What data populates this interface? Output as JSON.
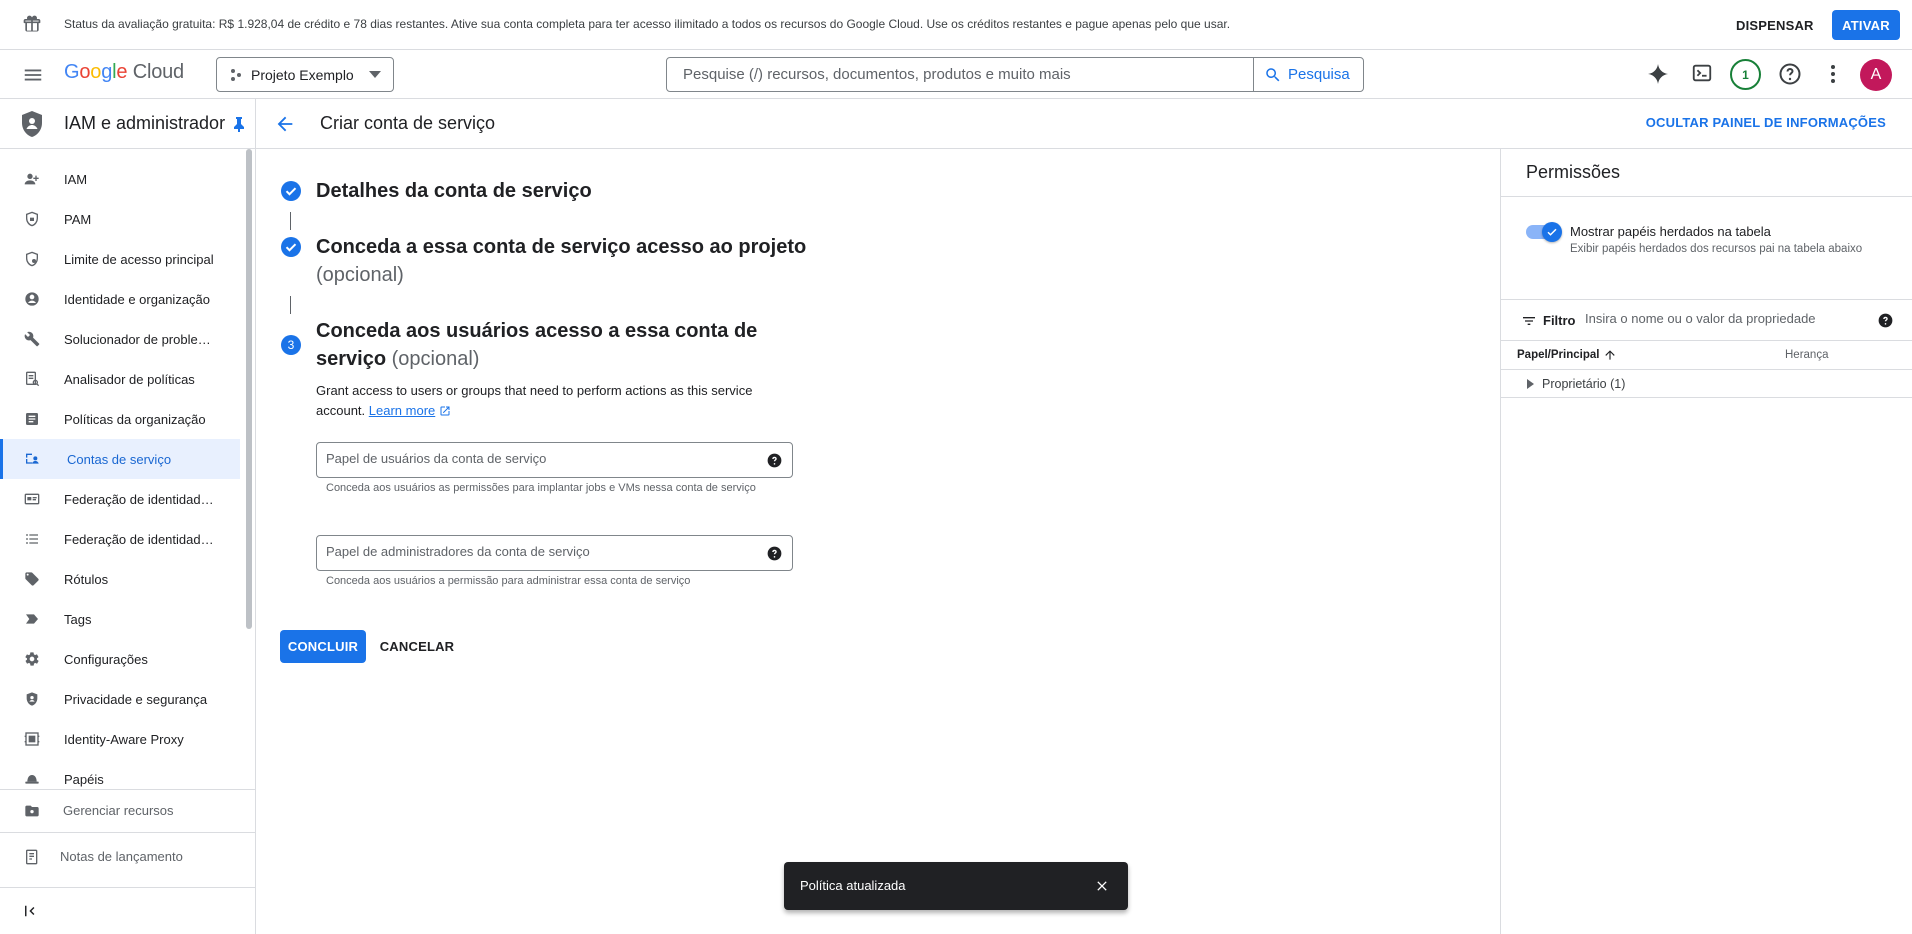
{
  "banner": {
    "text": "Status da avaliação gratuita: R$ 1.928,04 de crédito e 78 dias restantes. Ative sua conta completa para ter acesso ilimitado a todos os recursos do Google Cloud. Use os créditos restantes e pague apenas pelo que usar.",
    "dismiss_label": "DISPENSAR",
    "activate_label": "ATIVAR"
  },
  "topbar": {
    "logo_google": [
      "G",
      "o",
      "o",
      "g",
      "l",
      "e"
    ],
    "logo_cloud": "Cloud",
    "project_name": "Projeto Exemplo",
    "search_placeholder": "Pesquise (/) recursos, documentos, produtos e muito mais",
    "search_button": "Pesquisa",
    "notifications_count": "1",
    "avatar_letter": "A"
  },
  "sidebar": {
    "title": "IAM e administrador",
    "items": [
      {
        "label": "IAM",
        "icon": "person-add-icon"
      },
      {
        "label": "PAM",
        "icon": "shield-lock-icon"
      },
      {
        "label": "Limite de acesso principal",
        "icon": "shield-settings-icon"
      },
      {
        "label": "Identidade e organização",
        "icon": "account-circle-icon"
      },
      {
        "label": "Solucionador de problemas de política",
        "icon": "wrench-icon"
      },
      {
        "label": "Analisador de políticas",
        "icon": "policy-doc-icon"
      },
      {
        "label": "Políticas da organização",
        "icon": "article-icon"
      },
      {
        "label": "Contas de serviço",
        "icon": "service-account-icon",
        "active": true
      },
      {
        "label": "Federação de identidade da carga de trabalho",
        "icon": "badge-icon"
      },
      {
        "label": "Federação de identidade de colaboradores",
        "icon": "list-icon"
      },
      {
        "label": "Rótulos",
        "icon": "label-icon"
      },
      {
        "label": "Tags",
        "icon": "tag-arrow-icon"
      },
      {
        "label": "Configurações",
        "icon": "gear-icon"
      },
      {
        "label": "Privacidade e segurança",
        "icon": "privacy-shield-icon"
      },
      {
        "label": "Identity-Aware Proxy",
        "icon": "proxy-icon"
      },
      {
        "label": "Papéis",
        "icon": "hat-icon"
      }
    ],
    "manage_resources": "Gerenciar recursos",
    "release_notes": "Notas de lançamento"
  },
  "page": {
    "title": "Criar conta de serviço",
    "hide_panel": "OCULTAR PAINEL DE INFORMAÇÕES"
  },
  "steps": {
    "step1_title": "Detalhes da conta de serviço",
    "step2_title": "Conceda a essa conta de serviço acesso ao projeto",
    "step2_optional": "(opcional)",
    "step3_number": "3",
    "step3_title_line1": "Conceda aos usuários acesso a essa conta de",
    "step3_title_line2": "serviço",
    "step3_optional": "(opcional)",
    "description": "Grant access to users or groups that need to perform actions as this service account.",
    "learn_more": "Learn more"
  },
  "fields": {
    "users_role_placeholder": "Papel de usuários da conta de serviço",
    "users_role_hint": "Conceda aos usuários as permissões para implantar jobs e VMs nessa conta de serviço",
    "admins_role_placeholder": "Papel de administradores da conta de serviço",
    "admins_role_hint": "Conceda aos usuários a permissão para administrar essa conta de serviço"
  },
  "actions": {
    "done": "CONCLUIR",
    "cancel": "CANCELAR"
  },
  "panel": {
    "title": "Permissões",
    "toggle_label": "Mostrar papéis herdados na tabela",
    "toggle_sub": "Exibir papéis herdados dos recursos pai na tabela abaixo",
    "toggle_on": true,
    "filter_label": "Filtro",
    "filter_placeholder": "Insira o nome ou o valor da propriedade",
    "col_role": "Papel/Principal",
    "col_inheritance": "Herança",
    "rows": [
      {
        "label": "Proprietário (1)"
      }
    ]
  },
  "snackbar": {
    "text": "Política atualizada"
  },
  "colors": {
    "accent": "#1a73e8",
    "active_bg": "#e8f0fe",
    "avatar": "#c2185b",
    "notif": "#188038",
    "snackbar": "#202124"
  }
}
